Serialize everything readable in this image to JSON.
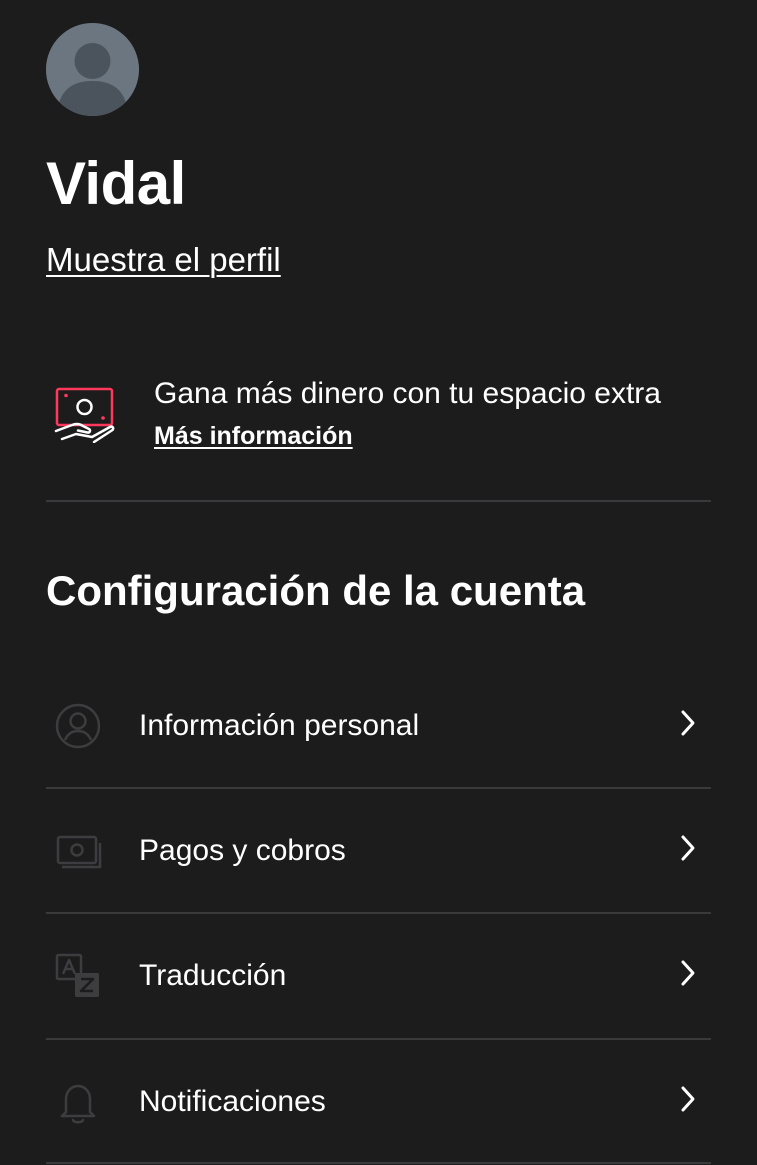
{
  "profile": {
    "name": "Vidal",
    "show_profile_label": "Muestra el perfil"
  },
  "promo": {
    "title": "Gana más dinero con tu espacio extra",
    "link_label": "Más información",
    "icon": "hosting-money-hand-icon"
  },
  "account_settings": {
    "title": "Configuración de la cuenta",
    "items": [
      {
        "label": "Información personal",
        "icon": "person-circle-icon"
      },
      {
        "label": "Pagos y cobros",
        "icon": "payments-icon"
      },
      {
        "label": "Traducción",
        "icon": "translate-icon"
      },
      {
        "label": "Notificaciones",
        "icon": "bell-icon"
      }
    ]
  },
  "colors": {
    "background": "#1c1c1d",
    "text": "#ffffff",
    "divider": "#3a3a3c",
    "icon_muted": "#3d3d40",
    "accent": "#ff385c",
    "avatar": "#6b7680"
  }
}
